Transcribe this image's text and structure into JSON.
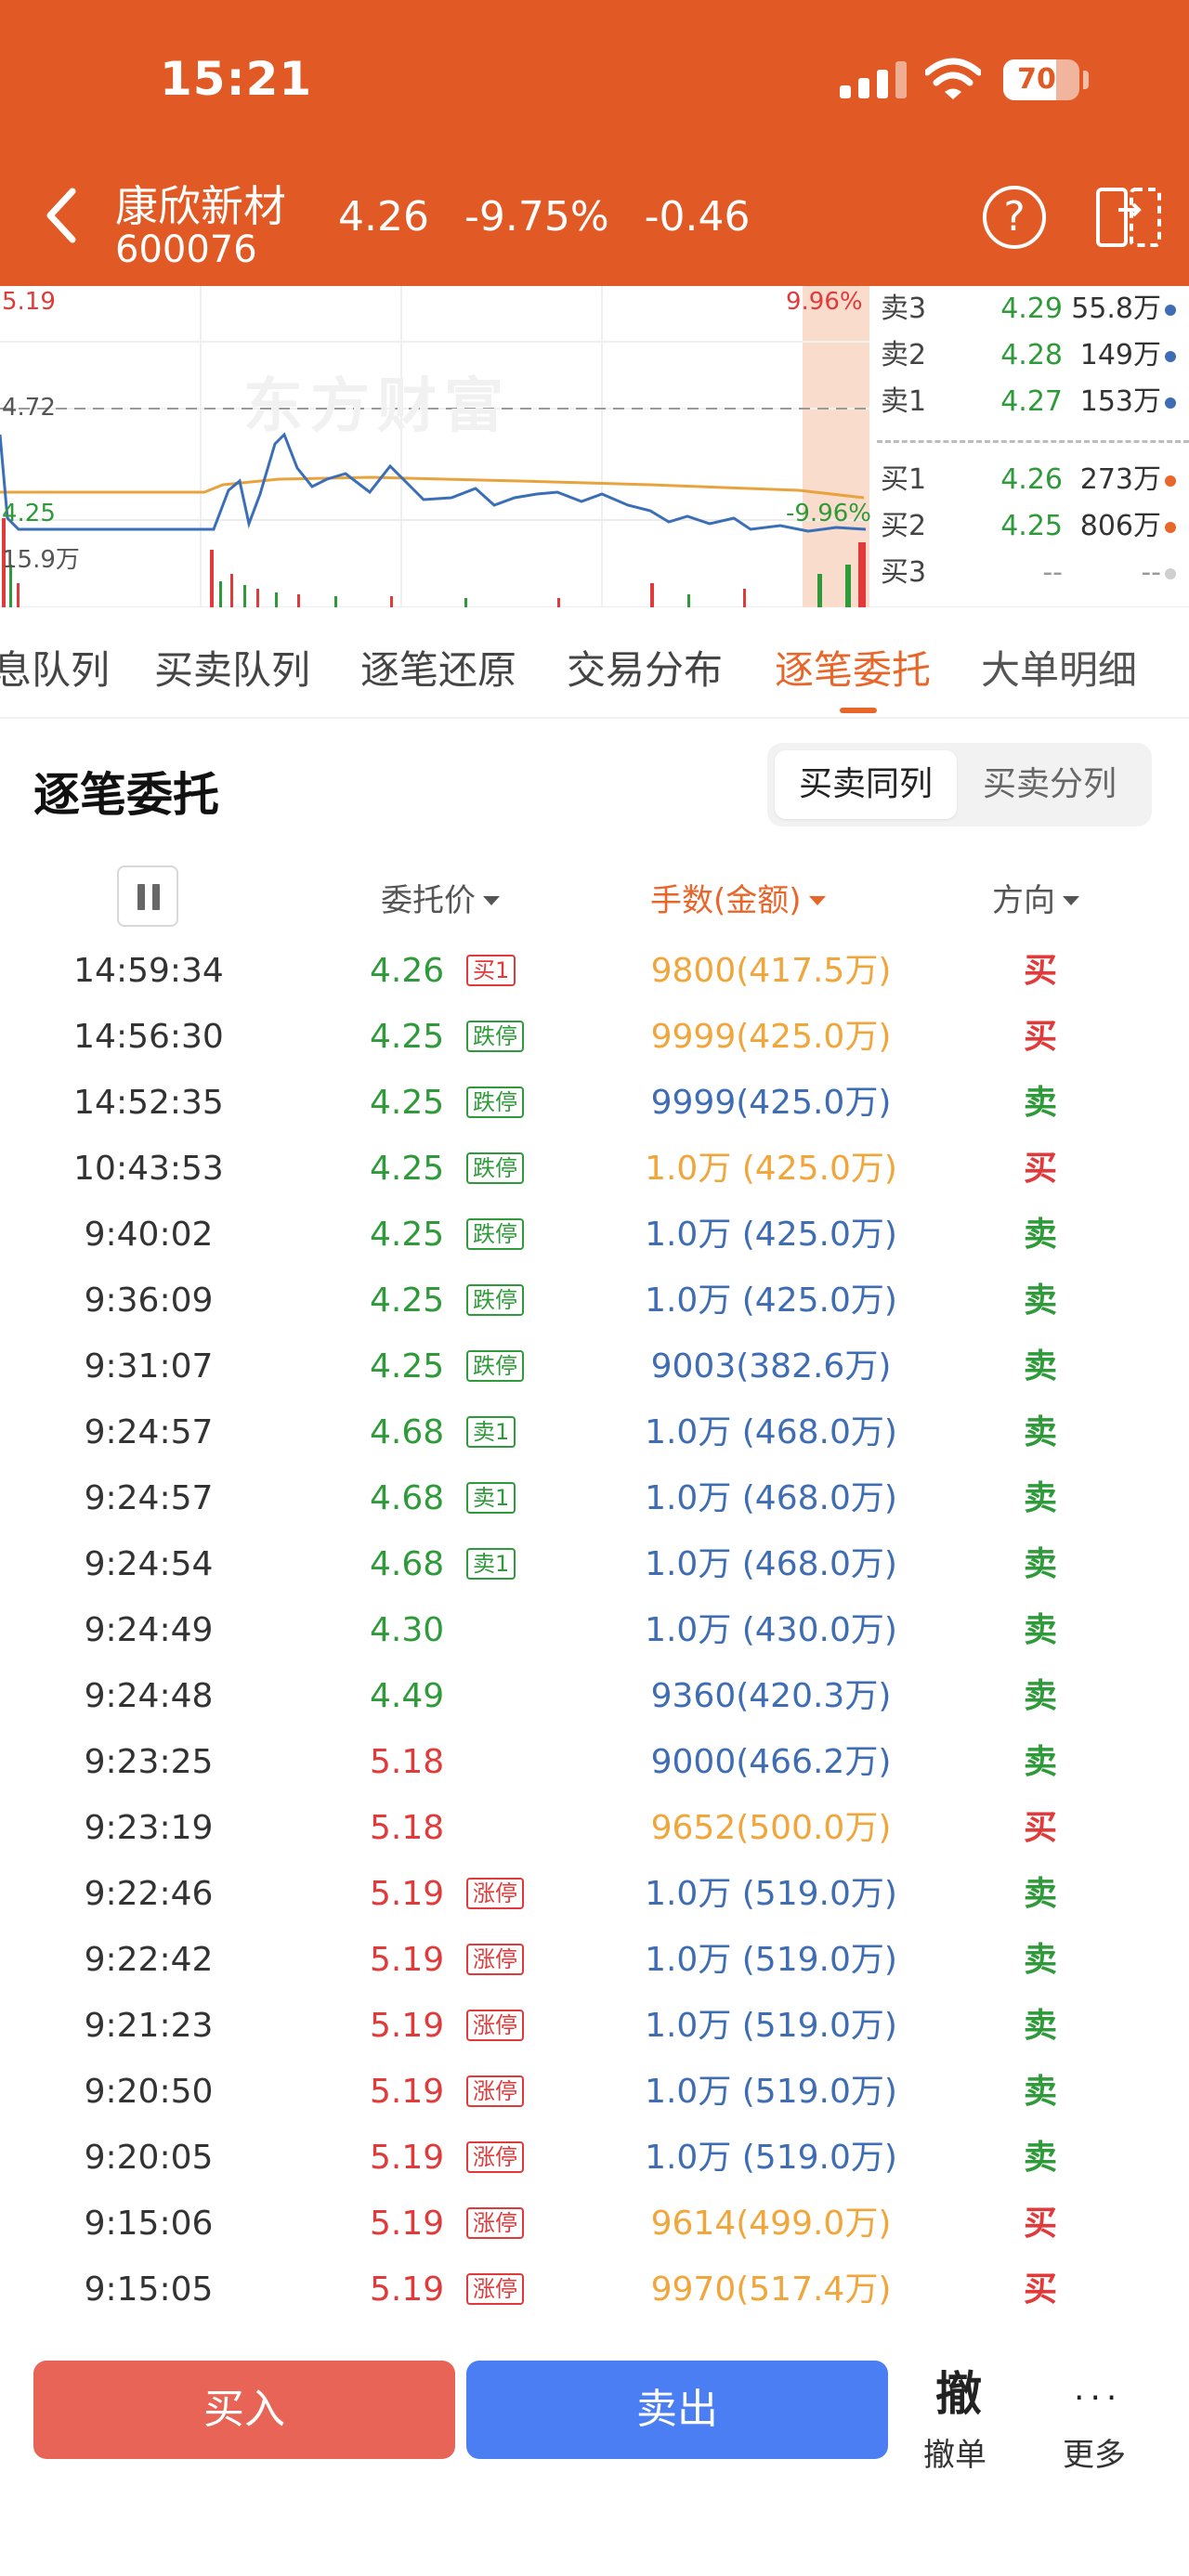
{
  "status": {
    "time": "15:21",
    "battery": "70",
    "battery_level": 0.7
  },
  "header": {
    "name": "康欣新材",
    "code": "600076",
    "price": "4.26",
    "change_pct": "-9.75%",
    "change": "-0.46",
    "help_symbol": "?"
  },
  "chart": {
    "watermark": "东方财富",
    "high": "5.19",
    "mid": "4.72",
    "low": "4.25",
    "volume": "15.9万",
    "pct_up": "9.96%",
    "pct_down": "-9.96%"
  },
  "orderbook": {
    "asks": [
      {
        "name": "卖3",
        "price": "4.29",
        "vol": "55.8万"
      },
      {
        "name": "卖2",
        "price": "4.28",
        "vol": "149万"
      },
      {
        "name": "卖1",
        "price": "4.27",
        "vol": "153万"
      }
    ],
    "bids": [
      {
        "name": "买1",
        "price": "4.26",
        "vol": "273万"
      },
      {
        "name": "买2",
        "price": "4.25",
        "vol": "806万"
      },
      {
        "name": "买3",
        "price": "--",
        "vol": "--"
      }
    ]
  },
  "tabs": [
    "息队列",
    "买卖队列",
    "逐笔还原",
    "交易分布",
    "逐笔委托",
    "大单明细"
  ],
  "section": {
    "title": "逐笔委托",
    "toggle_active": "买卖同列",
    "toggle_inactive": "买卖分列"
  },
  "columns": {
    "price": "委托价",
    "qty": "手数(金额)",
    "direction": "方向"
  },
  "colors": {
    "red": "#e03a3a",
    "green": "#2f9a3a",
    "blue": "#3f6db3",
    "orange": "#f0a63a",
    "accent": "#e8662a",
    "header_bg": "#e15a25"
  },
  "rows": [
    {
      "time": "14:59:34",
      "price": "4.26",
      "pc": "green",
      "tag": "买1",
      "tc": "red",
      "qty": "9800(417.5万)",
      "qc": "orange",
      "dir": "买",
      "dc": "red"
    },
    {
      "time": "14:56:30",
      "price": "4.25",
      "pc": "green",
      "tag": "跌停",
      "tc": "green",
      "qty": "9999(425.0万)",
      "qc": "orange",
      "dir": "买",
      "dc": "red"
    },
    {
      "time": "14:52:35",
      "price": "4.25",
      "pc": "green",
      "tag": "跌停",
      "tc": "green",
      "qty": "9999(425.0万)",
      "qc": "blue",
      "dir": "卖",
      "dc": "green"
    },
    {
      "time": "10:43:53",
      "price": "4.25",
      "pc": "green",
      "tag": "跌停",
      "tc": "green",
      "qty": "1.0万 (425.0万)",
      "qc": "orange",
      "dir": "买",
      "dc": "red"
    },
    {
      "time": "9:40:02",
      "price": "4.25",
      "pc": "green",
      "tag": "跌停",
      "tc": "green",
      "qty": "1.0万 (425.0万)",
      "qc": "blue",
      "dir": "卖",
      "dc": "green"
    },
    {
      "time": "9:36:09",
      "price": "4.25",
      "pc": "green",
      "tag": "跌停",
      "tc": "green",
      "qty": "1.0万 (425.0万)",
      "qc": "blue",
      "dir": "卖",
      "dc": "green"
    },
    {
      "time": "9:31:07",
      "price": "4.25",
      "pc": "green",
      "tag": "跌停",
      "tc": "green",
      "qty": "9003(382.6万)",
      "qc": "blue",
      "dir": "卖",
      "dc": "green"
    },
    {
      "time": "9:24:57",
      "price": "4.68",
      "pc": "green",
      "tag": "卖1",
      "tc": "green",
      "qty": "1.0万 (468.0万)",
      "qc": "blue",
      "dir": "卖",
      "dc": "green"
    },
    {
      "time": "9:24:57",
      "price": "4.68",
      "pc": "green",
      "tag": "卖1",
      "tc": "green",
      "qty": "1.0万 (468.0万)",
      "qc": "blue",
      "dir": "卖",
      "dc": "green"
    },
    {
      "time": "9:24:54",
      "price": "4.68",
      "pc": "green",
      "tag": "卖1",
      "tc": "green",
      "qty": "1.0万 (468.0万)",
      "qc": "blue",
      "dir": "卖",
      "dc": "green"
    },
    {
      "time": "9:24:49",
      "price": "4.30",
      "pc": "green",
      "tag": "",
      "tc": "green",
      "qty": "1.0万 (430.0万)",
      "qc": "blue",
      "dir": "卖",
      "dc": "green"
    },
    {
      "time": "9:24:48",
      "price": "4.49",
      "pc": "green",
      "tag": "",
      "tc": "green",
      "qty": "9360(420.3万)",
      "qc": "blue",
      "dir": "卖",
      "dc": "green"
    },
    {
      "time": "9:23:25",
      "price": "5.18",
      "pc": "red",
      "tag": "",
      "tc": "red",
      "qty": "9000(466.2万)",
      "qc": "blue",
      "dir": "卖",
      "dc": "green"
    },
    {
      "time": "9:23:19",
      "price": "5.18",
      "pc": "red",
      "tag": "",
      "tc": "red",
      "qty": "9652(500.0万)",
      "qc": "orange",
      "dir": "买",
      "dc": "red"
    },
    {
      "time": "9:22:46",
      "price": "5.19",
      "pc": "red",
      "tag": "涨停",
      "tc": "red",
      "qty": "1.0万 (519.0万)",
      "qc": "blue",
      "dir": "卖",
      "dc": "green"
    },
    {
      "time": "9:22:42",
      "price": "5.19",
      "pc": "red",
      "tag": "涨停",
      "tc": "red",
      "qty": "1.0万 (519.0万)",
      "qc": "blue",
      "dir": "卖",
      "dc": "green"
    },
    {
      "time": "9:21:23",
      "price": "5.19",
      "pc": "red",
      "tag": "涨停",
      "tc": "red",
      "qty": "1.0万 (519.0万)",
      "qc": "blue",
      "dir": "卖",
      "dc": "green"
    },
    {
      "time": "9:20:50",
      "price": "5.19",
      "pc": "red",
      "tag": "涨停",
      "tc": "red",
      "qty": "1.0万 (519.0万)",
      "qc": "blue",
      "dir": "卖",
      "dc": "green"
    },
    {
      "time": "9:20:05",
      "price": "5.19",
      "pc": "red",
      "tag": "涨停",
      "tc": "red",
      "qty": "1.0万 (519.0万)",
      "qc": "blue",
      "dir": "卖",
      "dc": "green"
    },
    {
      "time": "9:15:06",
      "price": "5.19",
      "pc": "red",
      "tag": "涨停",
      "tc": "red",
      "qty": "9614(499.0万)",
      "qc": "orange",
      "dir": "买",
      "dc": "red"
    },
    {
      "time": "9:15:05",
      "price": "5.19",
      "pc": "red",
      "tag": "涨停",
      "tc": "red",
      "qty": "9970(517.4万)",
      "qc": "orange",
      "dir": "买",
      "dc": "red"
    }
  ],
  "bottom": {
    "buy": "买入",
    "sell": "卖出",
    "cancel_icon": "撤",
    "cancel": "撤单",
    "more_icon": "···",
    "more": "更多"
  }
}
